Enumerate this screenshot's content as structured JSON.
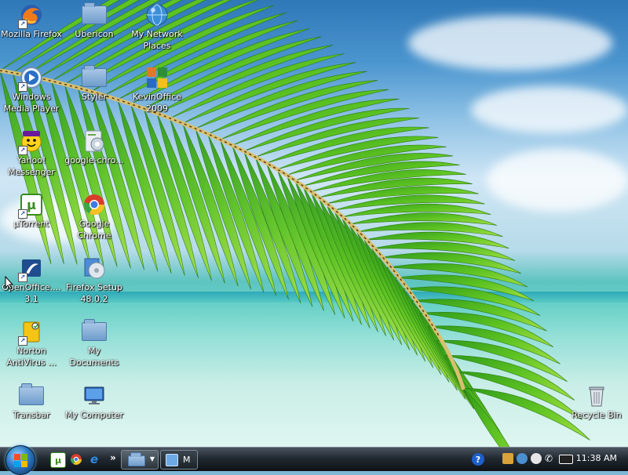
{
  "desktop": {
    "icons": [
      {
        "id": "firefox",
        "label": "Mozilla Firefox",
        "icon": "firefox-icon"
      },
      {
        "id": "ubericon",
        "label": "Ubericon",
        "icon": "folder-icon"
      },
      {
        "id": "network",
        "label": "My Network Places",
        "icon": "network-globe-icon"
      },
      {
        "id": "wmp",
        "label": "Windows Media Player",
        "icon": "media-player-icon"
      },
      {
        "id": "styler",
        "label": "Styler",
        "icon": "folder-icon"
      },
      {
        "id": "kevinoffice",
        "label": "KevinOffice 2009",
        "icon": "office-suite-icon"
      },
      {
        "id": "yahoo",
        "label": "Yahoo! Messenger",
        "icon": "yahoo-messenger-icon"
      },
      {
        "id": "chrome-installer",
        "label": "google-chro...",
        "icon": "installer-icon"
      },
      {
        "id": "utorrent",
        "label": "µTorrent",
        "icon": "utorrent-icon"
      },
      {
        "id": "chrome",
        "label": "Google Chrome",
        "icon": "chrome-icon"
      },
      {
        "id": "openoffice",
        "label": "OpenOffice.... 3.1",
        "icon": "openoffice-icon"
      },
      {
        "id": "firefox-setup",
        "label": "Firefox Setup 48.0.2",
        "icon": "setup-disc-icon"
      },
      {
        "id": "norton",
        "label": "Norton AntiVirus ...",
        "icon": "norton-icon"
      },
      {
        "id": "mydocs",
        "label": "My Documents",
        "icon": "documents-folder-icon"
      },
      {
        "id": "transbar",
        "label": "Transbar",
        "icon": "folder-icon"
      },
      {
        "id": "mycomputer",
        "label": "My Computer",
        "icon": "computer-icon"
      },
      {
        "id": "recycle",
        "label": "Recycle Bin",
        "icon": "recycle-bin-icon"
      }
    ]
  },
  "taskbar": {
    "quicklaunch": [
      {
        "name": "utorrent-icon",
        "glyph": "µ"
      },
      {
        "name": "chrome-icon",
        "glyph": ""
      },
      {
        "name": "ie-icon",
        "glyph": "e"
      }
    ],
    "overflow_glyph": "»",
    "task_button_label": "M",
    "help_glyph": "?",
    "clock": "11:38 AM"
  }
}
